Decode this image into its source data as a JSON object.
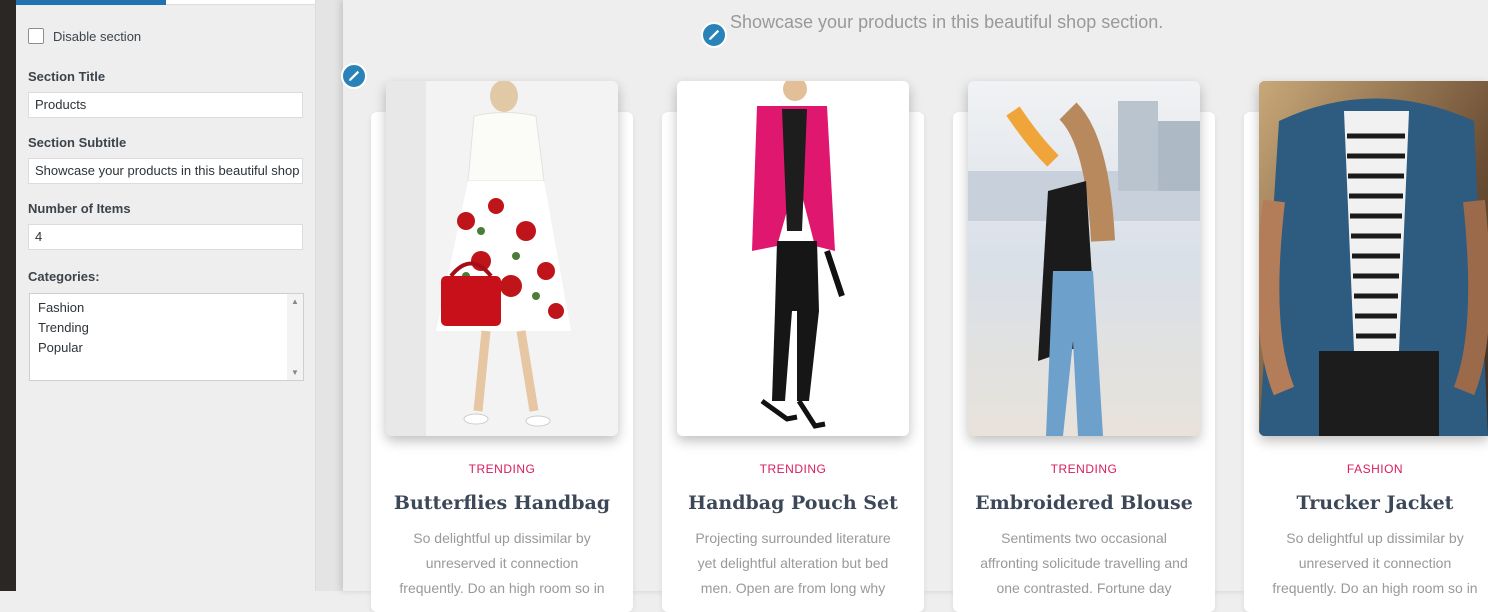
{
  "customizer": {
    "disable_label": "Disable section",
    "title_label": "Section Title",
    "title_value": "Products",
    "subtitle_label": "Section Subtitle",
    "subtitle_value": "Showcase your products in this beautiful shop section.",
    "items_label": "Number of Items",
    "items_value": "4",
    "categories_label": "Categories:",
    "categories": [
      "Fashion",
      "Trending",
      "Popular"
    ]
  },
  "preview": {
    "subtitle": "Showcase your products in this beautiful shop section.",
    "products": [
      {
        "category": "TRENDING",
        "title": "Butterflies Handbag",
        "description": "So delightful up dissimilar by unreserved it connection frequently. Do an high room so in"
      },
      {
        "category": "TRENDING",
        "title": "Handbag Pouch Set",
        "description": "Projecting surrounded literature yet delightful alteration but bed men. Open are from long why"
      },
      {
        "category": "TRENDING",
        "title": "Embroidered Blouse",
        "description": "Sentiments two occasional affronting solicitude travelling and one contrasted. Fortune day"
      },
      {
        "category": "FASHION",
        "title": "Trucker Jacket",
        "description": "So delightful up dissimilar by unreserved it connection frequently. Do an high room so in"
      }
    ]
  },
  "colors": {
    "accent": "#2271b1",
    "category": "#d81b60",
    "edit_button": "#2a83b8"
  }
}
